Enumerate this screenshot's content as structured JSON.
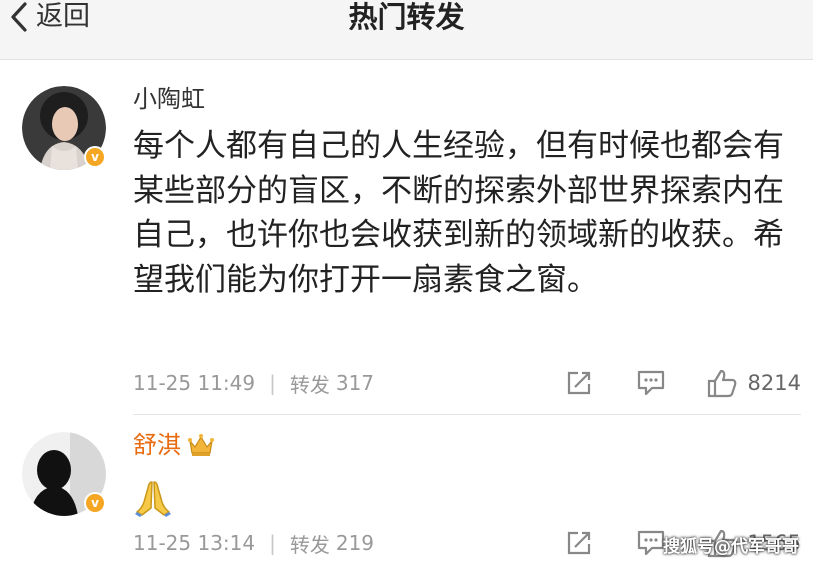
{
  "header": {
    "back_label": "返回",
    "title": "热门转发"
  },
  "posts": [
    {
      "author": "小陶虹",
      "verified": true,
      "content": "每个人都有自己的人生经验，但有时候也都会有某些部分的盲区，不断的探索外部世界探索内在自己，也许你也会收获到新的领域新的收获。希望我们能为你打开一扇素食之窗。",
      "time": "11-25 11:49",
      "repost_label": "转发",
      "repost_count": "317",
      "like_count": "8214"
    },
    {
      "author": "舒淇",
      "verified": true,
      "has_crown": true,
      "content_emoji": "pray-emoji",
      "time": "11-25 13:14",
      "repost_label": "转发",
      "repost_count": "219",
      "like_count": "1565"
    }
  ],
  "icons": {
    "back": "chevron-left-icon",
    "share": "share-icon",
    "comment": "comment-icon",
    "like": "thumbs-up-icon",
    "verified": "verified-badge-icon",
    "crown": "crown-icon"
  },
  "colors": {
    "header_bg": "#f5f5f5",
    "vip_name": "#e86b10",
    "verified_badge": "#f5a623",
    "meta_text": "#999999"
  },
  "watermark": "搜狐号@代军哥哥"
}
